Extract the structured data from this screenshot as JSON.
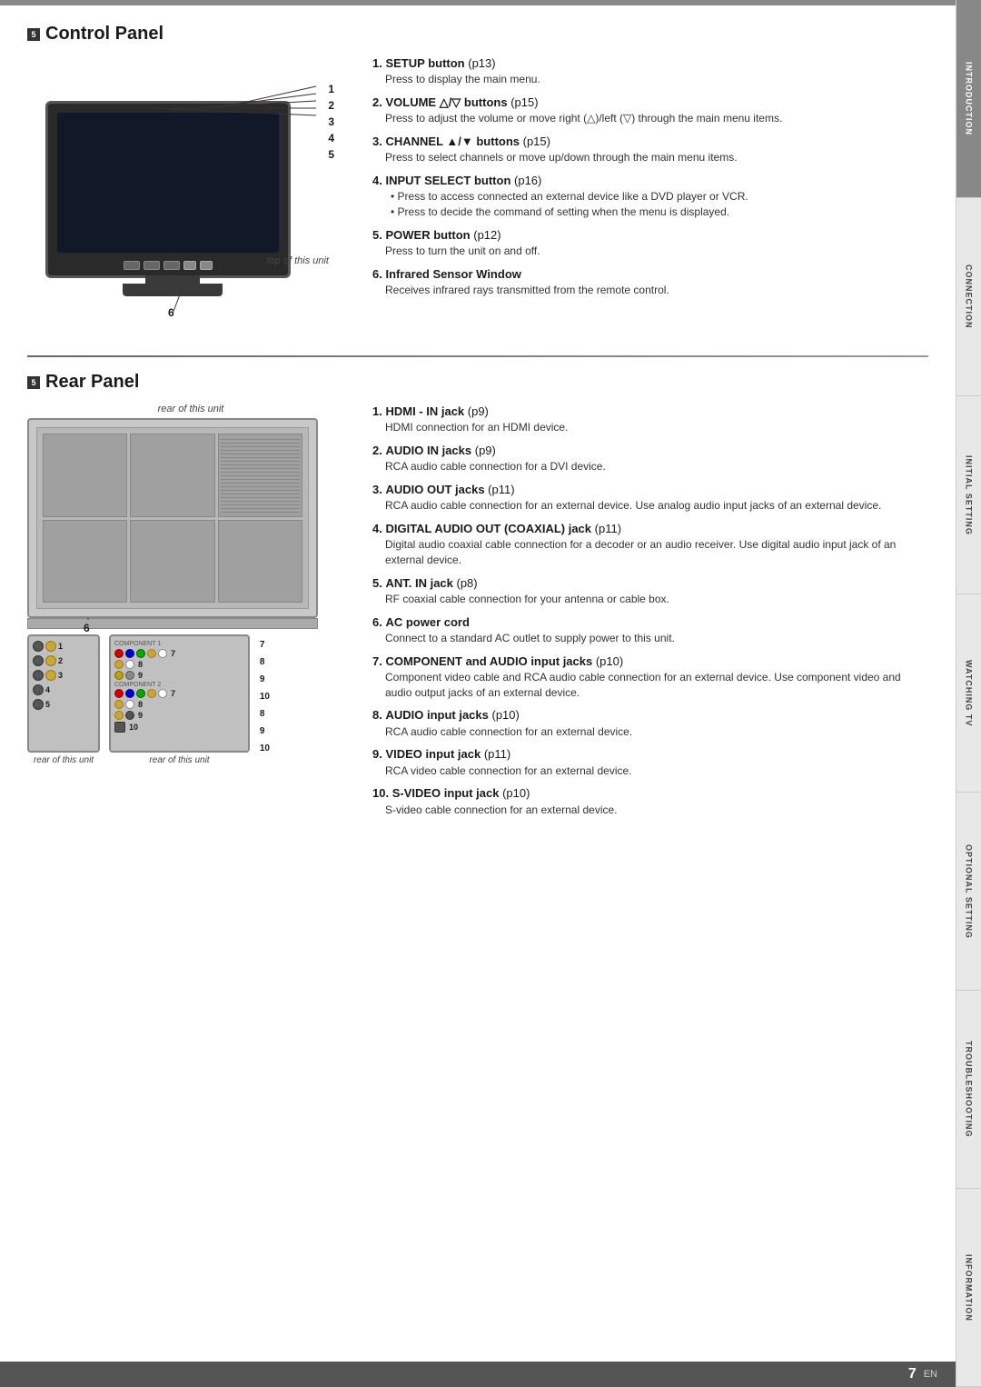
{
  "page": {
    "page_number": "7",
    "page_lang": "EN"
  },
  "sidebar_tabs": [
    {
      "label": "INTRODUCTION",
      "active": true
    },
    {
      "label": "CONNECTION",
      "active": false
    },
    {
      "label": "INITIAL SETTING",
      "active": false
    },
    {
      "label": "WATCHING TV",
      "active": false
    },
    {
      "label": "OPTIONAL SETTING",
      "active": false
    },
    {
      "label": "TROUBLESHOOTING",
      "active": false
    },
    {
      "label": "INFORMATION",
      "active": false
    }
  ],
  "control_panel": {
    "section_marker": "5",
    "title": "Control Panel",
    "diagram_label": "top of this unit",
    "callout_numbers": [
      "1",
      "2",
      "3",
      "4",
      "5",
      "6"
    ],
    "items": [
      {
        "num": "1.",
        "title": "SETUP button",
        "ref": "p13",
        "desc": "Press to display the main menu.",
        "bullets": []
      },
      {
        "num": "2.",
        "title": "VOLUME △/▽ buttons",
        "ref": "p15",
        "desc": "Press to adjust the volume or move right (△)/left (▽) through the main menu items.",
        "bullets": []
      },
      {
        "num": "3.",
        "title": "CHANNEL ▲/▼ buttons",
        "ref": "p15",
        "desc": "Press to select channels or move up/down through the main menu items.",
        "bullets": []
      },
      {
        "num": "4.",
        "title": "INPUT SELECT button",
        "ref": "p16",
        "desc": "",
        "bullets": [
          "Press to access connected an external device like a DVD player or VCR.",
          "Press to decide the command of setting when the menu is displayed."
        ]
      },
      {
        "num": "5.",
        "title": "POWER button",
        "ref": "p12",
        "desc": "Press to turn the unit on and off.",
        "bullets": []
      },
      {
        "num": "6.",
        "title": "Infrared Sensor Window",
        "ref": "",
        "desc": "Receives infrared rays transmitted from the remote control.",
        "bullets": []
      }
    ]
  },
  "rear_panel": {
    "section_marker": "5",
    "title": "Rear Panel",
    "diagram_label_top": "rear of this unit",
    "diagram_label_left": "rear of this unit",
    "diagram_label_right": "rear of this unit",
    "items": [
      {
        "num": "1.",
        "title": "HDMI - IN jack",
        "ref": "p9",
        "desc": "HDMI connection for an HDMI device.",
        "bullets": []
      },
      {
        "num": "2.",
        "title": "AUDIO IN jacks",
        "ref": "p9",
        "desc": "RCA audio cable connection for a DVI device.",
        "bullets": []
      },
      {
        "num": "3.",
        "title": "AUDIO OUT jacks",
        "ref": "p11",
        "desc": "RCA audio cable connection for an external device. Use analog audio input jacks of an external device.",
        "bullets": []
      },
      {
        "num": "4.",
        "title": "DIGITAL AUDIO OUT (COAXIAL) jack",
        "ref": "p11",
        "desc": "Digital audio coaxial cable connection for a decoder or an audio receiver. Use digital audio input jack of an external device.",
        "bullets": []
      },
      {
        "num": "5.",
        "title": "ANT. IN jack",
        "ref": "p8",
        "desc": "RF coaxial cable connection for your antenna or cable box.",
        "bullets": []
      },
      {
        "num": "6.",
        "title": "AC power cord",
        "ref": "",
        "desc": "Connect to a standard AC outlet to supply power to this unit.",
        "bullets": []
      },
      {
        "num": "7.",
        "title": "COMPONENT and AUDIO input jacks",
        "ref": "p10",
        "desc": "Component video cable and RCA audio cable connection for an external device. Use component video and audio output jacks of an external device.",
        "bullets": []
      },
      {
        "num": "8.",
        "title": "AUDIO input jacks",
        "ref": "p10",
        "desc": "RCA audio cable connection for an external device.",
        "bullets": []
      },
      {
        "num": "9.",
        "title": "VIDEO input jack",
        "ref": "p11",
        "desc": "RCA video cable connection for an external device.",
        "bullets": []
      },
      {
        "num": "10.",
        "title": "S-VIDEO input jack",
        "ref": "p10",
        "desc": "S-video cable connection for an external device.",
        "bullets": []
      }
    ]
  }
}
